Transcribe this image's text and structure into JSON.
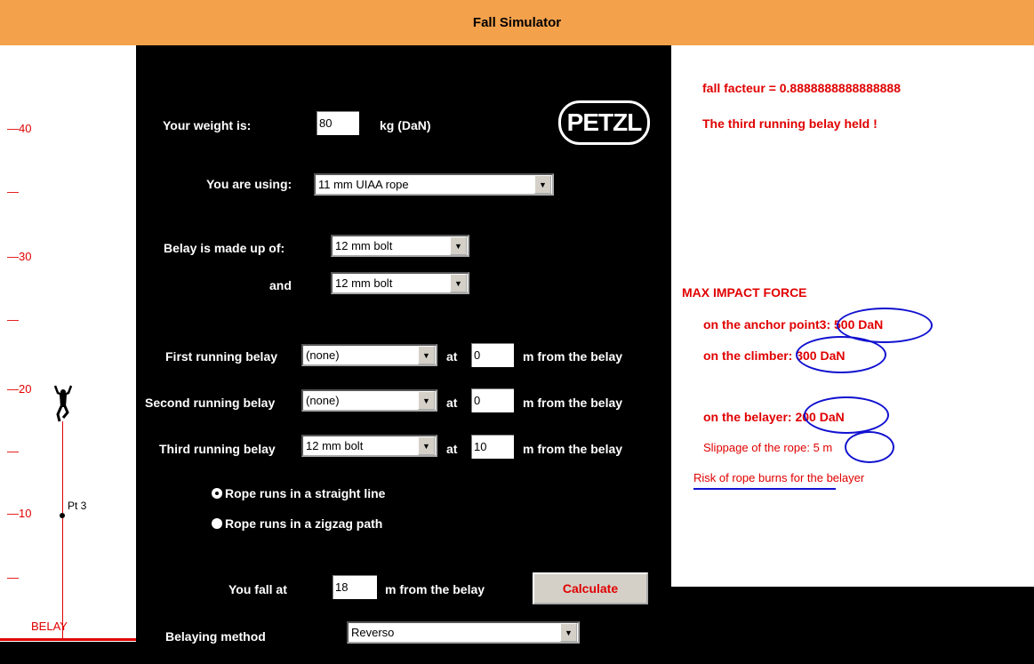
{
  "title": "Fall Simulator",
  "scale": {
    "labels": [
      "40",
      "30",
      "20",
      "10"
    ],
    "dash": "—",
    "belay_label": "BELAY",
    "point_label": "Pt 3",
    "climber_icon": "climber-figure-icon"
  },
  "form": {
    "weight_label": "Your weight is:",
    "weight_value": "80",
    "weight_unit": "kg (DaN)",
    "logo_text": "PETZL",
    "rope_label": "You are using:",
    "rope_value": "11 mm UIAA rope",
    "belay_label": "Belay is made up of:",
    "belay_value1": "12 mm bolt",
    "and_label": "and",
    "belay_value2": "12 mm bolt",
    "runs": [
      {
        "label": "First running belay",
        "select": "(none)",
        "at": "at",
        "distance": "0",
        "suffix": "m from the belay"
      },
      {
        "label": "Second running belay",
        "select": "(none)",
        "at": "at",
        "distance": "0",
        "suffix": "m from the belay"
      },
      {
        "label": "Third running belay",
        "select": "12 mm bolt",
        "at": "at",
        "distance": "10",
        "suffix": "m from the belay"
      }
    ],
    "radio_straight": "Rope runs in a  straight line",
    "radio_zigzag": "Rope runs in a zigzag path",
    "fall_label": "You fall at",
    "fall_value": "18",
    "fall_suffix": "m from the belay",
    "calculate": "Calculate",
    "method_label": "Belaying method",
    "method_value": "Reverso"
  },
  "results": {
    "fall_factor": "fall facteur = 0.8888888888888888",
    "held": "The third running belay held !",
    "max_impact": "MAX IMPACT FORCE",
    "anchor": "on the anchor point3: 500 DaN",
    "climber": "on the climber: 300 DaN",
    "belayer": "on the belayer: 200 DaN",
    "slippage": "Slippage of the rope: 5 m",
    "risk_link": "Risk of rope burns",
    "risk_rest": " for the belayer"
  },
  "colors": {
    "title_bar": "#f4a14c",
    "accent_red": "#e00000",
    "oval_blue": "#1010d0"
  }
}
